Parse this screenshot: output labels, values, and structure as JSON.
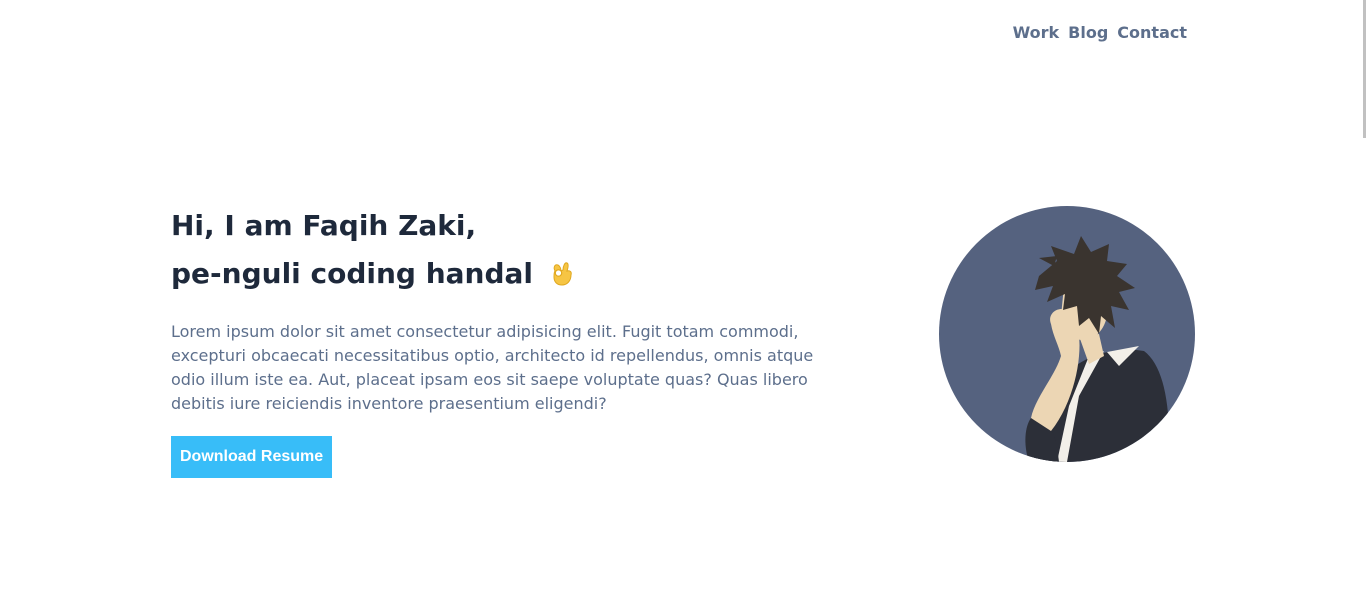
{
  "nav": {
    "items": [
      {
        "label": "Work"
      },
      {
        "label": "Blog"
      },
      {
        "label": "Contact"
      }
    ]
  },
  "hero": {
    "line1": "Hi, I am Faqih Zaki,",
    "line2": "pe-nguli coding handal",
    "emoji_icon": "ok-hand-icon",
    "description": "Lorem ipsum dolor sit amet consectetur adipisicing elit. Fugit totam commodi, excepturi obcaecati necessitatibus optio, architecto id repellendus, omnis atque odio illum iste ea. Aut, placeat ipsam eos sit saepe voluptate quas? Quas libero debitis iure reiciendis inventore praesentium eligendi?",
    "button_label": "Download Resume"
  },
  "colors": {
    "nav_text": "#5d6f8c",
    "heading": "#1e293b",
    "body_text": "#5d6f8c",
    "button_bg": "#38bdf8",
    "avatar_bg": "#55627f"
  }
}
